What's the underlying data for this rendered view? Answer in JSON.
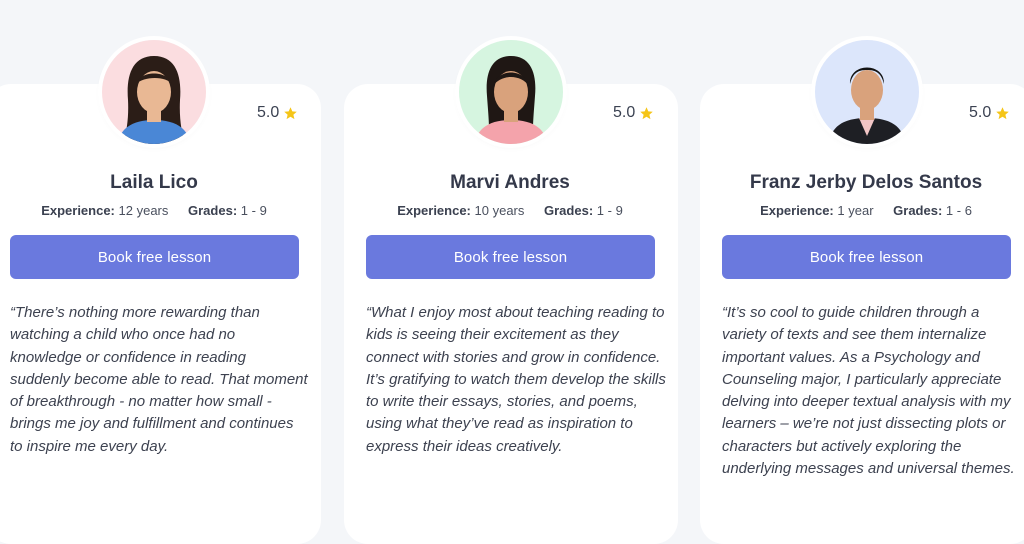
{
  "tutors": [
    {
      "name": "Laila Lico",
      "rating": "5.0",
      "experience_label": "Experience:",
      "experience": "12 years",
      "grades_label": "Grades:",
      "grades": "1 - 9",
      "button_label": "Book free lesson",
      "quote": "“There’s nothing more rewarding than watching a child who once had no knowledge or confidence in reading suddenly become able to read. That moment of breakthrough - no matter how small - brings me joy and fulfillment and continues to inspire me every day.",
      "avatar_bg": "#fbdde0"
    },
    {
      "name": "Marvi Andres",
      "rating": "5.0",
      "experience_label": "Experience:",
      "experience": "10 years",
      "grades_label": "Grades:",
      "grades": "1 - 9",
      "button_label": "Book free lesson",
      "quote": "“What I enjoy most about teaching reading to kids is seeing their excitement as they connect with stories and grow in confidence. It’s gratifying to watch them develop the skills to write their essays, stories, and poems, using what they’ve read as inspiration to express their ideas creatively.",
      "avatar_bg": "#d6f5e0"
    },
    {
      "name": "Franz Jerby Delos Santos",
      "rating": "5.0",
      "experience_label": "Experience:",
      "experience": "1 year",
      "grades_label": "Grades:",
      "grades": "1 - 6",
      "button_label": "Book free lesson",
      "quote": "“It’s so cool to guide children through a variety of texts and see them internalize important values. As a Psychology and Counseling major, I particularly appreciate delving into deeper textual analysis with my learners – we’re not just dissecting plots or characters but actively exploring the underlying messages and universal themes.",
      "avatar_bg": "#dce6fb"
    }
  ],
  "colors": {
    "page_bg": "#f4f6f9",
    "card_bg": "#ffffff",
    "button_bg": "#6a79de",
    "star": "#f5c518"
  },
  "icons": {
    "rating": "star-icon"
  }
}
